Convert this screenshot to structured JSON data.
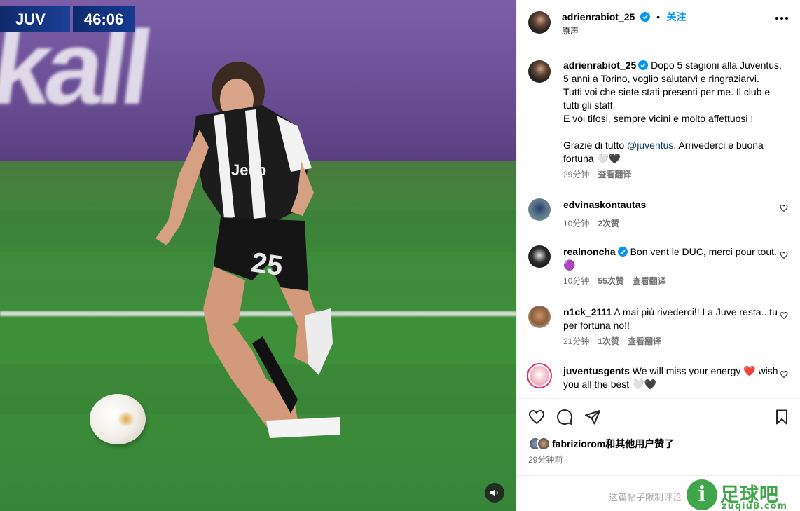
{
  "video": {
    "score_team": "JUV",
    "score_clock": "46:06",
    "board_text": "kall",
    "sound_icon": "speaker-icon"
  },
  "post": {
    "author": "adrienrabiot_25",
    "follow_label": "关注",
    "audio_label": "原声",
    "caption_lines": [
      "Dopo 5 stagioni alla Juventus,",
      "5 anni a Torino, voglio salutarvi e ringraziarvi.",
      "Tutti voi che siete stati presenti per me. Il club e",
      "tutti gli staff.",
      "E voi tifosi, sempre vicini e molto affettuosi !"
    ],
    "caption_thanks_prefix": "Grazie di tutto ",
    "caption_mention": "@juventus",
    "caption_thanks_suffix": ". Arrivederci e buona",
    "caption_last": "fortuna",
    "caption_emoji": "🤍🖤",
    "caption_time": "29分钟",
    "translate_label": "查看翻译"
  },
  "comments": [
    {
      "user": "edvinaskontautas",
      "text": "",
      "time": "10分钟",
      "likes": "2次赞",
      "translate": ""
    },
    {
      "user": "realnoncha",
      "verified": true,
      "text": "Bon vent le DUC, merci pour tout. 🟣",
      "time": "10分钟",
      "likes": "55次赞",
      "translate": "查看翻译"
    },
    {
      "user": "n1ck_2111",
      "text": "A mai più rivederci!! La Juve resta.. tu per fortuna no!!",
      "time": "21分钟",
      "likes": "1次赞",
      "translate": "查看翻译"
    },
    {
      "user": "juventusgents",
      "text": "We will miss your energy ❤️ wish you all the best 🤍🖤",
      "time": "",
      "likes": "",
      "translate": ""
    }
  ],
  "footer": {
    "liked_by": "fabriziorom和其他用户赞了",
    "time_ago": "29分钟前",
    "restricted_msg": "这篇帖子限制评论"
  },
  "watermark": {
    "cn": "足球吧",
    "en": "zuqiu8.com",
    "logo_glyph": "i"
  },
  "colors": {
    "accent": "#0095f6",
    "verified": "#0095f6",
    "watermark": "#3fa64a",
    "heart_red": "#ed4956"
  }
}
